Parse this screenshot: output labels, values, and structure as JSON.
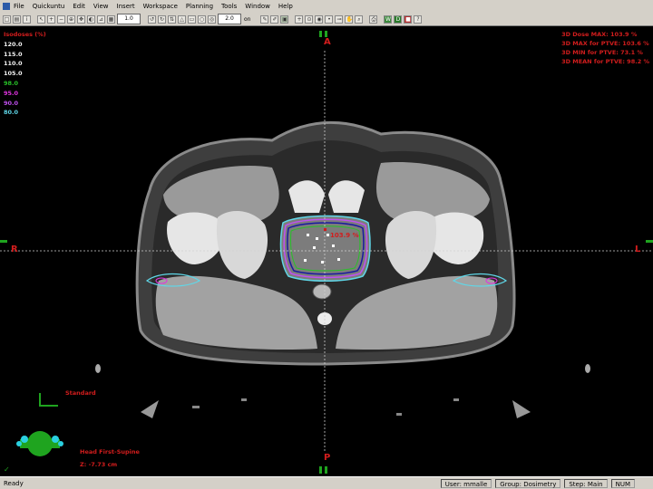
{
  "menu": [
    "File",
    "Quickuntu",
    "Edit",
    "View",
    "Insert",
    "Workspace",
    "Planning",
    "Tools",
    "Window",
    "Help"
  ],
  "toolbar": {
    "zoom_value": "1.0",
    "level_value": "2.0",
    "on_label": "on"
  },
  "isodose": {
    "title": "Isodoses (%)",
    "levels": [
      {
        "value": "120.0",
        "color": "#f2f2f2"
      },
      {
        "value": "115.0",
        "color": "#f2f2f2"
      },
      {
        "value": "110.0",
        "color": "#f2f2f2"
      },
      {
        "value": "105.0",
        "color": "#f2f2f2"
      },
      {
        "value": "98.0",
        "color": "#27c227"
      },
      {
        "value": "95.0",
        "color": "#e033e0"
      },
      {
        "value": "90.0",
        "color": "#c050f0"
      },
      {
        "value": "80.0",
        "color": "#5fd7e8"
      }
    ]
  },
  "dose_stats": [
    "3D Dose MAX: 103.9 %",
    "3D MAX for PTVE: 103.6 %",
    "3D MIN for PTVE: 73.1 %",
    "3D MEAN for PTVE: 98.2 %"
  ],
  "orientation": {
    "anterior": "A",
    "posterior": "P",
    "right": "R",
    "left": "L"
  },
  "hotspot_label": "103.9 %",
  "view_preset": "Standard",
  "patient_position": "Head First-Supine",
  "slice_position": "Z: -7.73 cm",
  "status": {
    "ready": "Ready",
    "user": "User: mmalle",
    "group": "Group: Dosimetry",
    "mode": "Step: Main",
    "caps": "NUM"
  },
  "colors": {
    "accent": "#d21d1d",
    "marker": "#1fa41f"
  }
}
